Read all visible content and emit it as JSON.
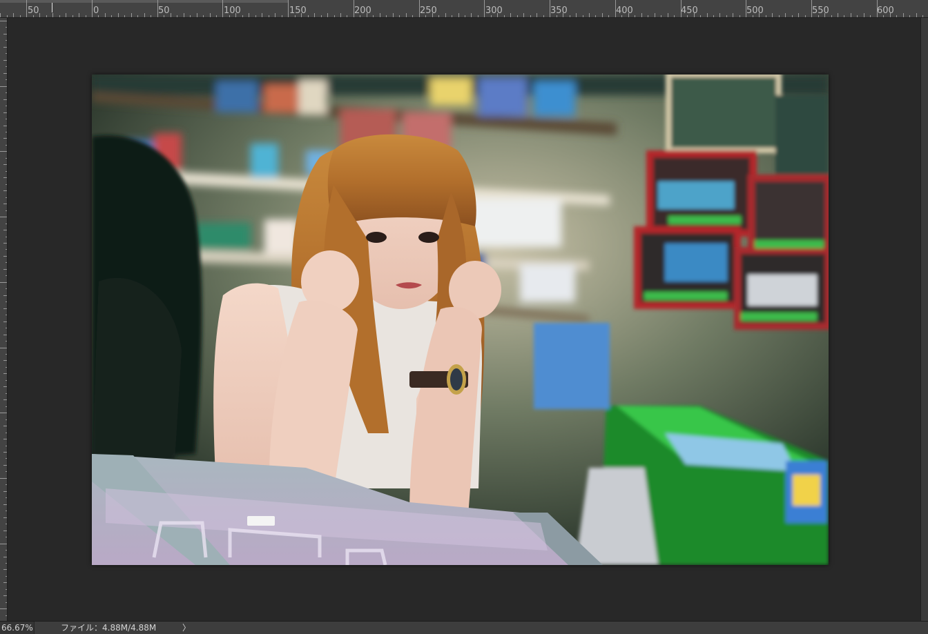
{
  "ruler": {
    "unit_labels": [
      "50",
      "0",
      "50",
      "100",
      "150",
      "200",
      "250",
      "300",
      "350",
      "400",
      "450",
      "500",
      "550",
      "600"
    ]
  },
  "document": {
    "image_alt": "portrait photo of a woman resting her chin on her hands at a shop counter"
  },
  "status_bar": {
    "zoom": "66.67%",
    "file_info": "ファイル：4.88M/4.88M",
    "menu_arrow": "〉"
  },
  "colors": {
    "ui_background": "#282828",
    "ruler_background": "#434343",
    "status_bar_background": "#3d3d3d"
  }
}
